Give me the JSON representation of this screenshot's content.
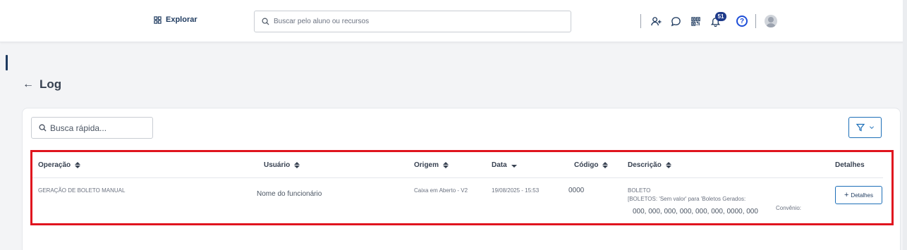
{
  "topbar": {
    "explore_label": "Explorar",
    "search_placeholder": "Buscar pelo aluno ou recursos",
    "notifications_count": "51",
    "help_label": "?",
    "icons": [
      "explore-grid-icon",
      "search-icon",
      "add-user-icon",
      "chat-icon",
      "qr-code-icon",
      "bell-icon",
      "help-icon",
      "avatar"
    ]
  },
  "page": {
    "back_label": "←",
    "title": "Log"
  },
  "toolbar": {
    "quick_search_placeholder": "Busca rápida..."
  },
  "table": {
    "columns": [
      {
        "label": "Operação",
        "sort": "none"
      },
      {
        "label": "Usuário",
        "sort": "none"
      },
      {
        "label": "Origem",
        "sort": "none"
      },
      {
        "label": "Data",
        "sort": "desc"
      },
      {
        "label": "Código",
        "sort": "none"
      },
      {
        "label": "Descrição",
        "sort": "none"
      },
      {
        "label": "Detalhes",
        "sort": "none"
      }
    ],
    "rows": [
      {
        "operacao": "GERAÇÃO DE BOLETO MANUAL",
        "usuario": "Nome do funcionário",
        "origem": "Caixa em Aberto - V2",
        "data": "19/08/2025 - 15:53",
        "codigo": "0000",
        "descricao_line1": "BOLETO",
        "descricao_line2": "[BOLETOS: 'Sem valor' para 'Boletos Gerados:",
        "descricao_line3": "000, 000, 000, 000, 000, 000, 0000, 000",
        "descricao_convenio": "Convênio:",
        "detalhes_label": "Detalhes"
      }
    ]
  },
  "colors": {
    "brand": "#1e3a5f",
    "accent": "#1d6fb8",
    "highlight": "#e0141e"
  }
}
